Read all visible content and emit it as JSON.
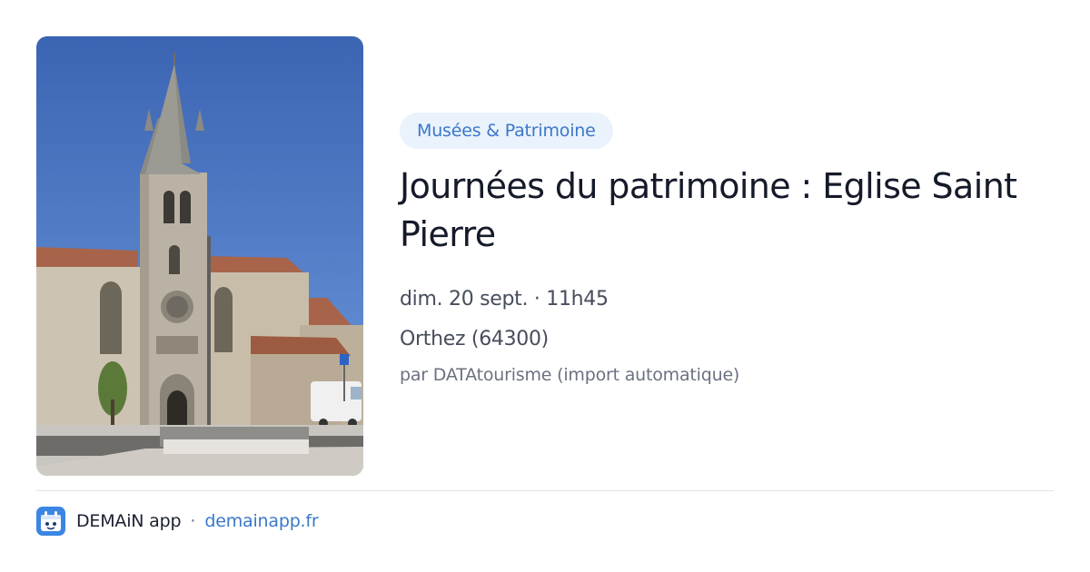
{
  "card": {
    "image_alt": "Eglise Saint Pierre",
    "category": "Musées & Patrimoine",
    "title": "Journées du patrimoine : Eglise Saint Pierre",
    "datetime": "dim. 20 sept. · 11h45",
    "location": "Orthez (64300)",
    "source": "par DATAtourisme (import automatique)"
  },
  "footer": {
    "logo_icon": "demain-app-logo-icon",
    "app_name": "DEMAiN app",
    "separator": "·",
    "link_text": "demainapp.fr"
  },
  "colors": {
    "accent": "#3a78c9",
    "pill_background": "#eaf2fc",
    "title": "#141a28",
    "meta": "#474d5c",
    "muted": "#6b7180",
    "divider": "#dde4ec"
  }
}
